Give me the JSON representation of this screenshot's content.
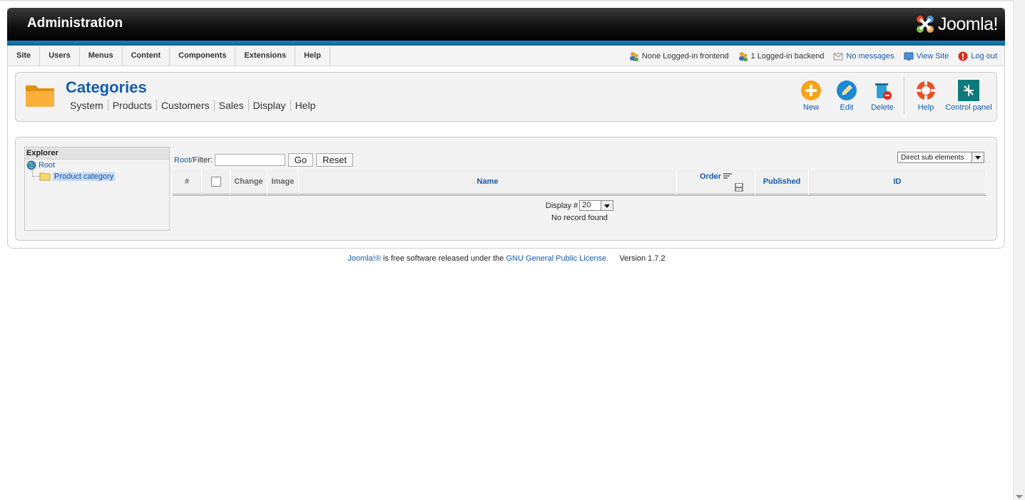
{
  "header": {
    "title": "Administration",
    "logo_text": "Joomla!"
  },
  "menu": [
    "Site",
    "Users",
    "Menus",
    "Content",
    "Components",
    "Extensions",
    "Help"
  ],
  "status": {
    "frontend": "None Logged-in frontend",
    "backend": "1 Logged-in backend",
    "messages": "No messages",
    "view_site": "View Site",
    "logout": "Log out"
  },
  "toolbar": {
    "title": "Categories",
    "submenu": [
      "System",
      "Products",
      "Customers",
      "Sales",
      "Display",
      "Help"
    ],
    "buttons": {
      "new": "New",
      "edit": "Edit",
      "delete": "Delete",
      "help": "Help",
      "control_panel": "Control panel"
    }
  },
  "explorer": {
    "title": "Explorer",
    "root": "Root",
    "child": "Product category"
  },
  "filter": {
    "root_link": "Root/",
    "label": "Filter:",
    "value": "",
    "go": "Go",
    "reset": "Reset",
    "scope_select": "Direct sub elements"
  },
  "grid": {
    "columns": {
      "num": "#",
      "change": "Change",
      "image": "Image",
      "name": "Name",
      "order": "Order",
      "published": "Published",
      "id": "ID"
    },
    "display_label": "Display #",
    "display_value": "20",
    "empty_message": "No record found"
  },
  "footer": {
    "joomla_link": "Joomla!®",
    "text": "is free software released under the",
    "license_link": "GNU General Public License.",
    "version": "Version 1.7.2"
  },
  "colors": {
    "accent": "#135cae",
    "header_bar": "#0b5f8f",
    "orange_icon": "#f7a21b"
  }
}
